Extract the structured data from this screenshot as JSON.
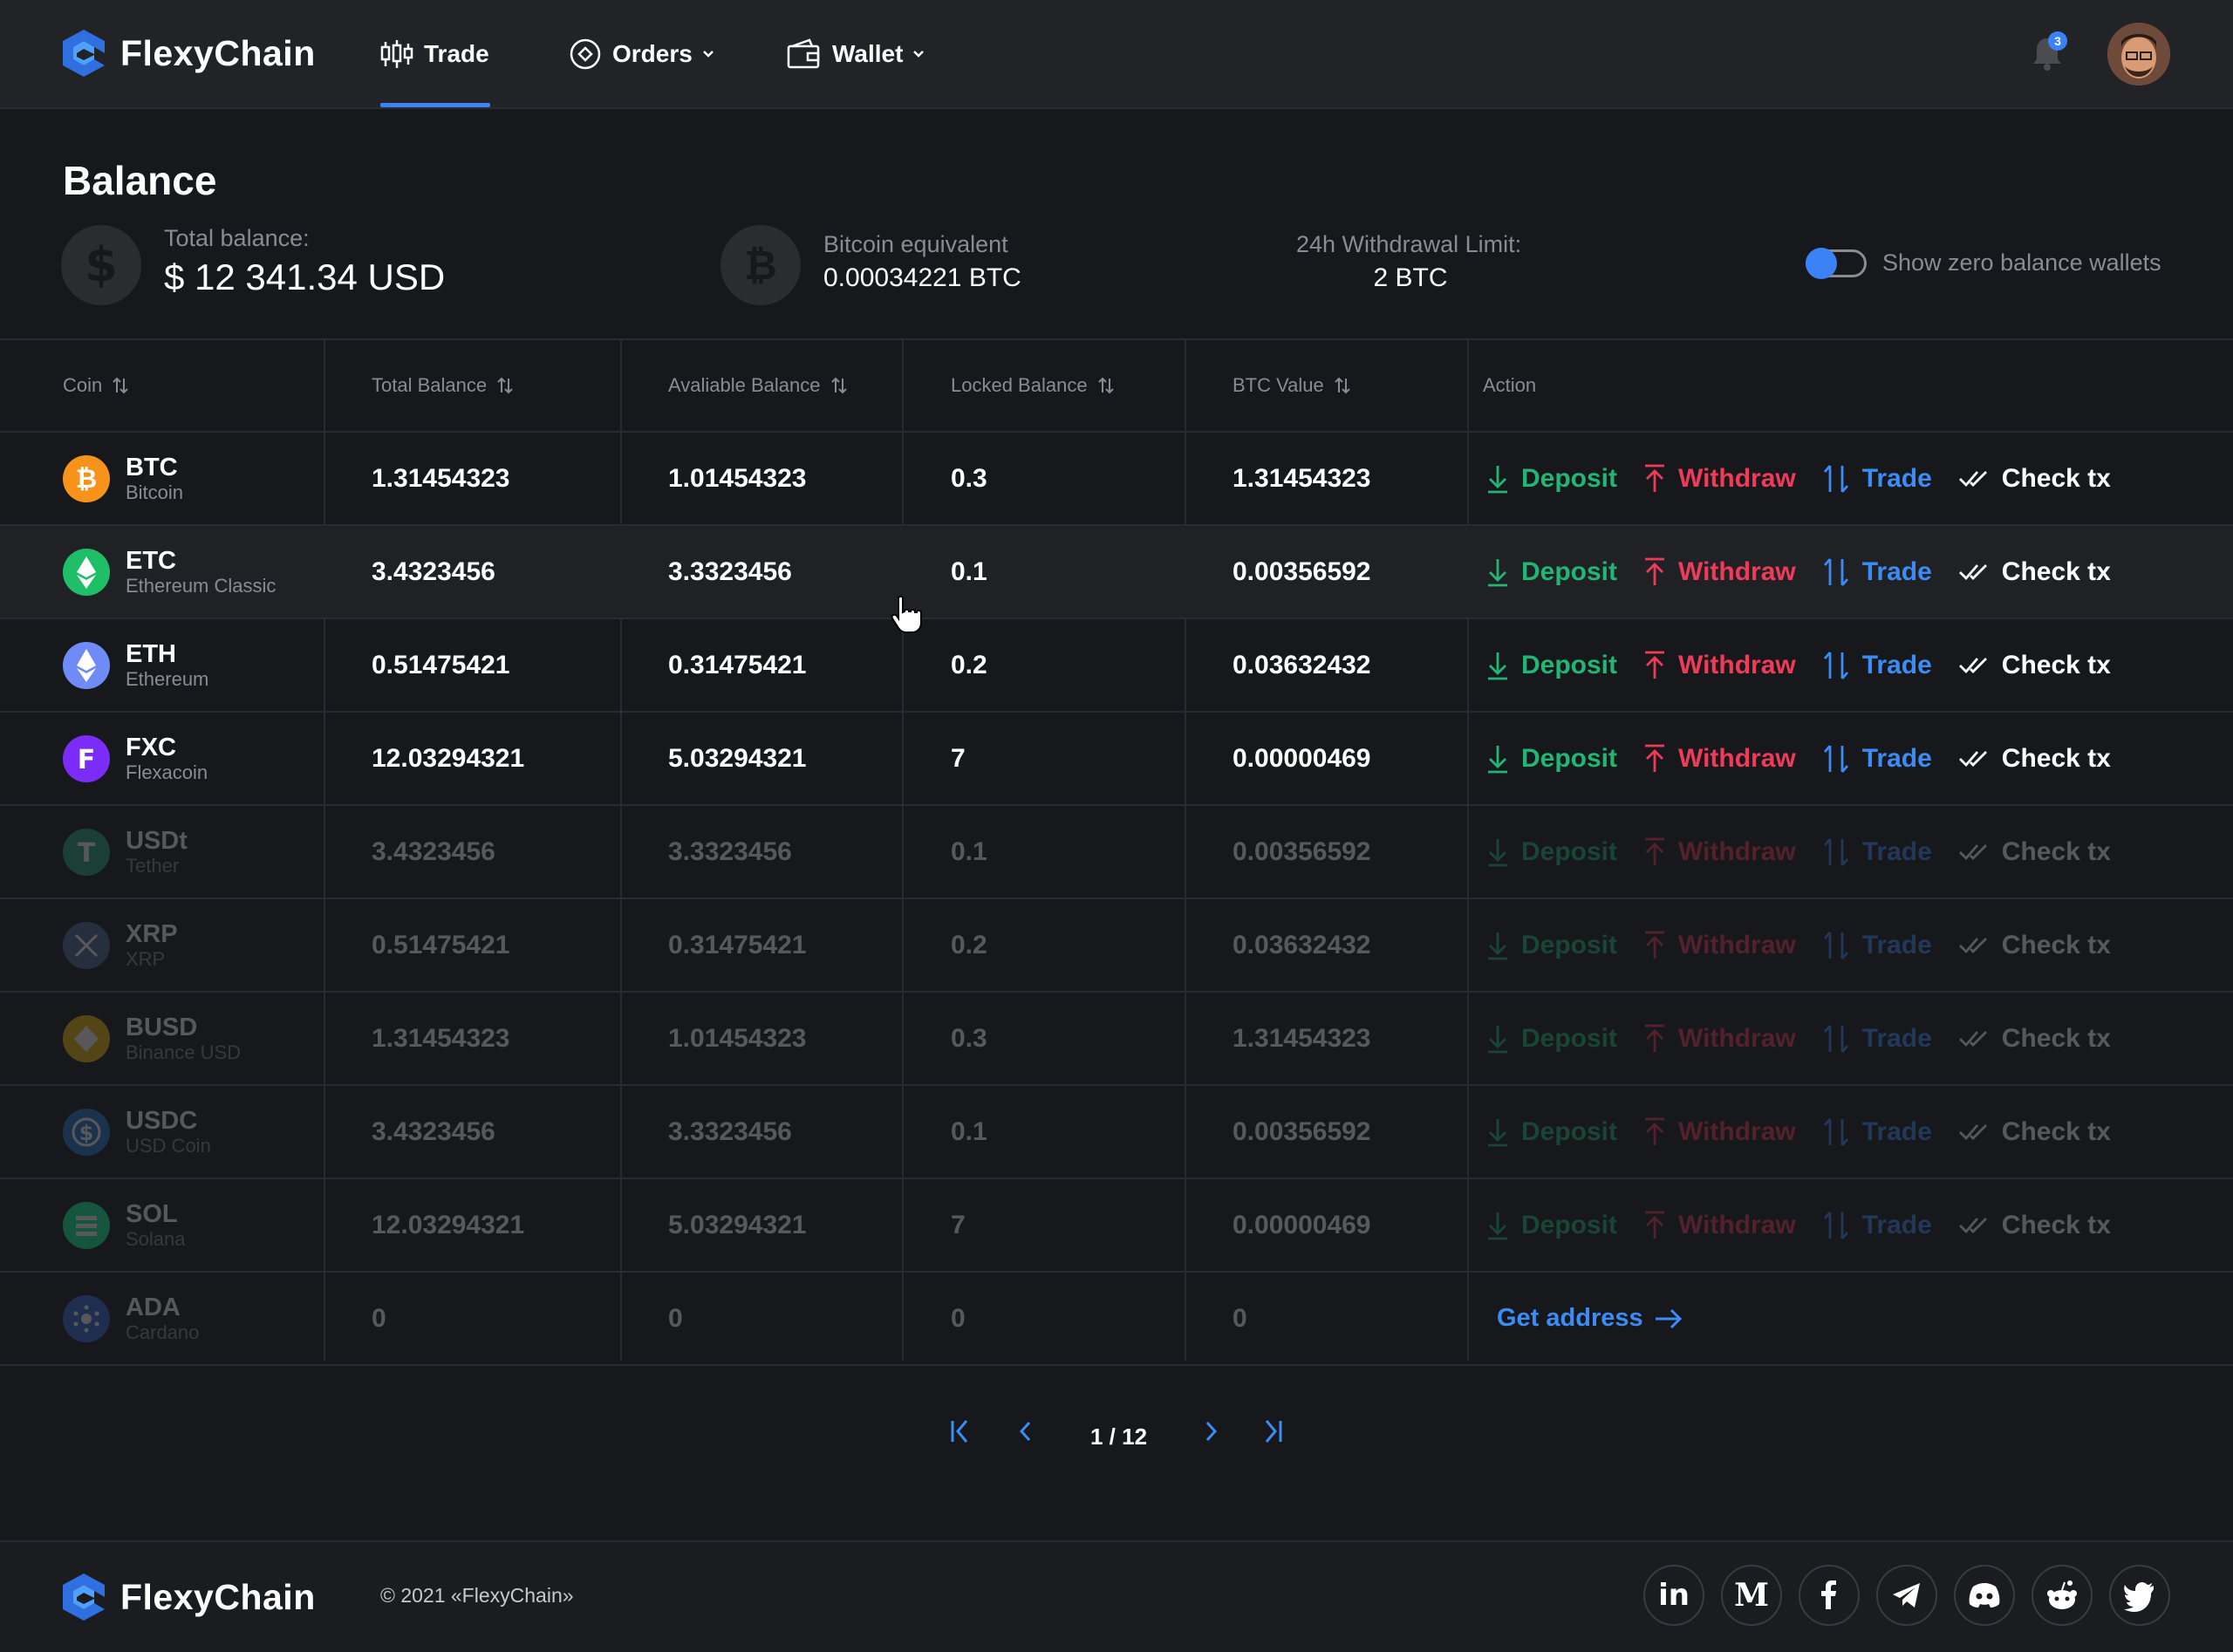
{
  "header": {
    "brand": "FlexyChain",
    "nav": [
      {
        "label": "Trade",
        "icon": "candlestick-icon"
      },
      {
        "label": "Orders",
        "icon": "orders-icon"
      },
      {
        "label": "Wallet",
        "icon": "wallet-icon"
      }
    ],
    "notifications_count": "3"
  },
  "balance": {
    "title": "Balance",
    "total_label": "Total balance:",
    "total_value": "$ 12 341.34 USD",
    "btc_label": "Bitcoin equivalent",
    "btc_value": "0.00034221 BTC",
    "limit_label": "24h Withdrawal Limit:",
    "limit_value": "2 BTC",
    "toggle_label": "Show zero balance wallets"
  },
  "table": {
    "columns": [
      "Coin",
      "Total Balance",
      "Avaliable Balance",
      "Locked Balance",
      "BTC Value",
      "Action"
    ],
    "actions": {
      "deposit": "Deposit",
      "withdraw": "Withdraw",
      "trade": "Trade",
      "check": "Check tx",
      "get_address": "Get address"
    },
    "rows": [
      {
        "symbol": "BTC",
        "name": "Bitcoin",
        "total": "1.31454323",
        "available": "1.01454323",
        "locked": "0.3",
        "btc": "1.31454323",
        "color": "#f7931a"
      },
      {
        "symbol": "ETC",
        "name": "Ethereum Classic",
        "total": "3.4323456",
        "available": "3.3323456",
        "locked": "0.1",
        "btc": "0.00356592",
        "color": "#1fbf6a"
      },
      {
        "symbol": "ETH",
        "name": "Ethereum",
        "total": "0.51475421",
        "available": "0.31475421",
        "locked": "0.2",
        "btc": "0.03632432",
        "color": "#6f8cf6"
      },
      {
        "symbol": "FXC",
        "name": "Flexacoin",
        "total": "12.03294321",
        "available": "5.03294321",
        "locked": "7",
        "btc": "0.00000469",
        "color": "#7b2cf6"
      },
      {
        "symbol": "USDt",
        "name": "Tether",
        "total": "3.4323456",
        "available": "3.3323456",
        "locked": "0.1",
        "btc": "0.00356592",
        "color": "#26a17b"
      },
      {
        "symbol": "XRP",
        "name": "XRP",
        "total": "0.51475421",
        "available": "0.31475421",
        "locked": "0.2",
        "btc": "0.03632432",
        "color": "#4a6a9a"
      },
      {
        "symbol": "BUSD",
        "name": "Binance USD",
        "total": "1.31454323",
        "available": "1.01454323",
        "locked": "0.3",
        "btc": "1.31454323",
        "color": "#f0b90b"
      },
      {
        "symbol": "USDC",
        "name": "USD Coin",
        "total": "3.4323456",
        "available": "3.3323456",
        "locked": "0.1",
        "btc": "0.00356592",
        "color": "#2775ca"
      },
      {
        "symbol": "SOL",
        "name": "Solana",
        "total": "12.03294321",
        "available": "5.03294321",
        "locked": "7",
        "btc": "0.00000469",
        "color": "#14f195"
      },
      {
        "symbol": "ADA",
        "name": "Cardano",
        "total": "0",
        "available": "0",
        "locked": "0",
        "btc": "0",
        "color": "#3468d1"
      }
    ]
  },
  "pagination": {
    "text": "1 / 12"
  },
  "footer": {
    "brand": "FlexyChain",
    "copyright": "© 2021 «FlexyChain»",
    "social": [
      "linkedin-icon",
      "medium-icon",
      "facebook-icon",
      "telegram-icon",
      "discord-icon",
      "reddit-icon",
      "twitter-icon"
    ]
  }
}
